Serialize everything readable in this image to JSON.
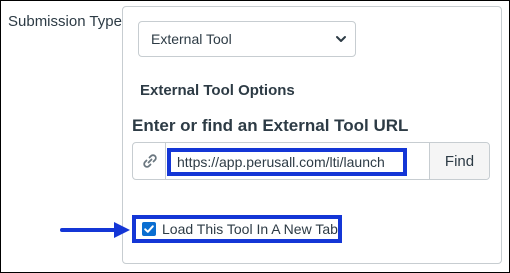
{
  "section_label": "Submission Type",
  "select": {
    "value": "External Tool",
    "icon": "chevron-down-icon"
  },
  "options_heading": "External Tool Options",
  "url_label": "Enter or find an External Tool URL",
  "url_input": {
    "value": "https://app.perusall.com/lti/launch",
    "icon": "link-icon"
  },
  "find_button": "Find",
  "checkbox": {
    "label": "Load This Tool In A New Tab",
    "checked": true
  },
  "colors": {
    "highlight": "#1436d6",
    "checkbox": "#0a6ed1",
    "text": "#2d3b45"
  }
}
